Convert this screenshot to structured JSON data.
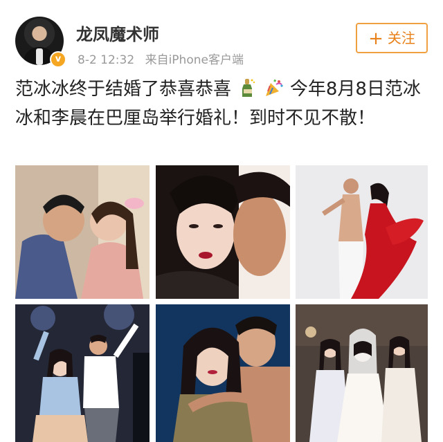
{
  "post": {
    "username": "龙凤魔术师",
    "time": "8-2 12:32",
    "source": "来自iPhone客户端",
    "follow_label": "关注",
    "text_part1": "范冰冰终于结婚了恭喜恭喜",
    "text_part2": "今年8月8日范冰冰和李晨在巴厘岛举行婚礼！到时不见不散！",
    "verified_badge": "v"
  },
  "icons": {
    "avatar": "user-avatar",
    "verified": "verified-badge-icon",
    "champagne": "champagne-emoji-icon",
    "party": "party-popper-emoji-icon",
    "plus": "plus-icon"
  },
  "photos": [
    {
      "name": "photo-couple-kiss",
      "bg": "#c9b59f"
    },
    {
      "name": "photo-couple-closeup",
      "bg": "#f2ebe6"
    },
    {
      "name": "photo-dance-red-dress",
      "bg": "#e9e9ec"
    },
    {
      "name": "photo-stage-show",
      "bg": "#2a2d3a"
    },
    {
      "name": "photo-couple-embrace",
      "bg": "#123a66"
    },
    {
      "name": "photo-bridesmaids",
      "bg": "#4a3e38"
    }
  ],
  "colors": {
    "accent": "#f5a623",
    "follow": "#e8811a",
    "meta": "#999999"
  }
}
